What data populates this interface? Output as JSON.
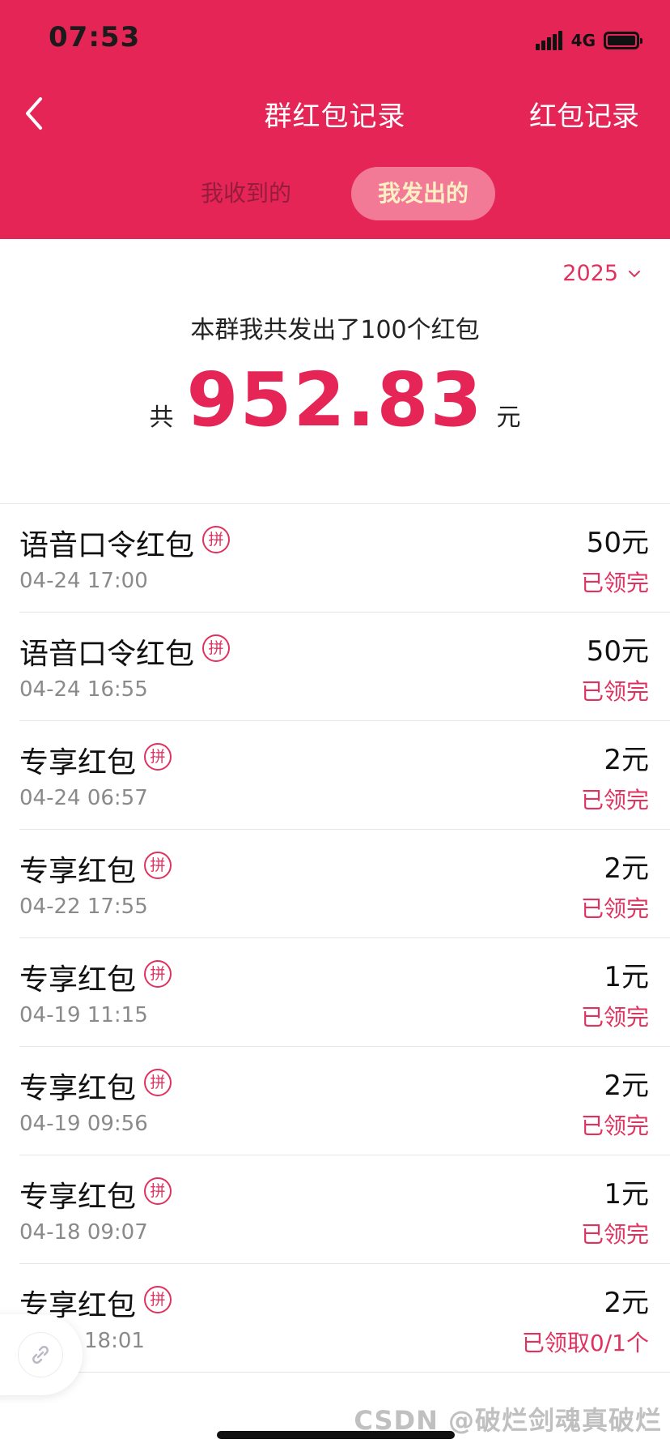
{
  "status_bar": {
    "time": "07:53",
    "network": "4G"
  },
  "nav": {
    "title": "群红包记录",
    "right_label": "红包记录"
  },
  "tabs": [
    {
      "label": "我收到的",
      "active": false
    },
    {
      "label": "我发出的",
      "active": true
    }
  ],
  "summary": {
    "year": "2025",
    "description": "本群我共发出了100个红包",
    "total_prefix": "共",
    "total_amount": "952.83",
    "total_unit": "元"
  },
  "records": [
    {
      "name": "语音口令红包",
      "badge": "拼",
      "time": "04-24 17:00",
      "amount": "50元",
      "status": "已领完"
    },
    {
      "name": "语音口令红包",
      "badge": "拼",
      "time": "04-24 16:55",
      "amount": "50元",
      "status": "已领完"
    },
    {
      "name": "专享红包",
      "badge": "拼",
      "time": "04-24 06:57",
      "amount": "2元",
      "status": "已领完"
    },
    {
      "name": "专享红包",
      "badge": "拼",
      "time": "04-22 17:55",
      "amount": "2元",
      "status": "已领完"
    },
    {
      "name": "专享红包",
      "badge": "拼",
      "time": "04-19 11:15",
      "amount": "1元",
      "status": "已领完"
    },
    {
      "name": "专享红包",
      "badge": "拼",
      "time": "04-19 09:56",
      "amount": "2元",
      "status": "已领完"
    },
    {
      "name": "专享红包",
      "badge": "拼",
      "time": "04-18 09:07",
      "amount": "1元",
      "status": "已领完"
    },
    {
      "name": "专享红包",
      "badge": "拼",
      "time": "18:01",
      "amount": "2元",
      "status": "已领取0/1个"
    }
  ],
  "watermark": "CSDN @破烂剑魂真破烂",
  "colors": {
    "brand_red": "#E52556",
    "accent_pink": "#E0325F",
    "active_tab_bg": "#F37A96",
    "active_tab_text": "#FDF0C4"
  },
  "icons": {
    "back": "chevron-left-icon",
    "year_dropdown": "chevron-down-icon",
    "float_button": "link-icon"
  }
}
